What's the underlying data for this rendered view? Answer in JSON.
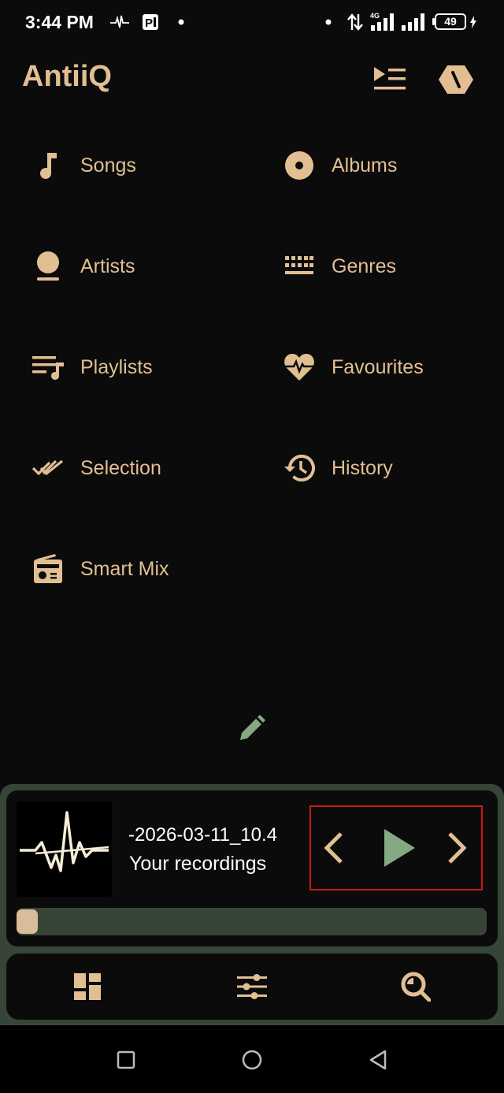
{
  "status_bar": {
    "time": "3:44 PM",
    "battery": "49"
  },
  "app": {
    "title": "AntiiQ"
  },
  "menu": [
    {
      "label": "Songs",
      "icon": "music-note-icon"
    },
    {
      "label": "Albums",
      "icon": "album-icon"
    },
    {
      "label": "Artists",
      "icon": "artist-icon"
    },
    {
      "label": "Genres",
      "icon": "genres-icon"
    },
    {
      "label": "Playlists",
      "icon": "playlist-icon"
    },
    {
      "label": "Favourites",
      "icon": "heart-pulse-icon"
    },
    {
      "label": "Selection",
      "icon": "double-check-icon"
    },
    {
      "label": "History",
      "icon": "history-icon"
    },
    {
      "label": "Smart Mix",
      "icon": "radio-icon"
    }
  ],
  "now_playing": {
    "title": "-2026-03-11_10.4",
    "subtitle": "Your recordings",
    "progress": 0.0
  },
  "colors": {
    "accent": "#e2bf93",
    "background": "#0b0b0b",
    "player_panel": "#364538",
    "play_button": "#86a883",
    "highlight_box": "#d01818"
  }
}
